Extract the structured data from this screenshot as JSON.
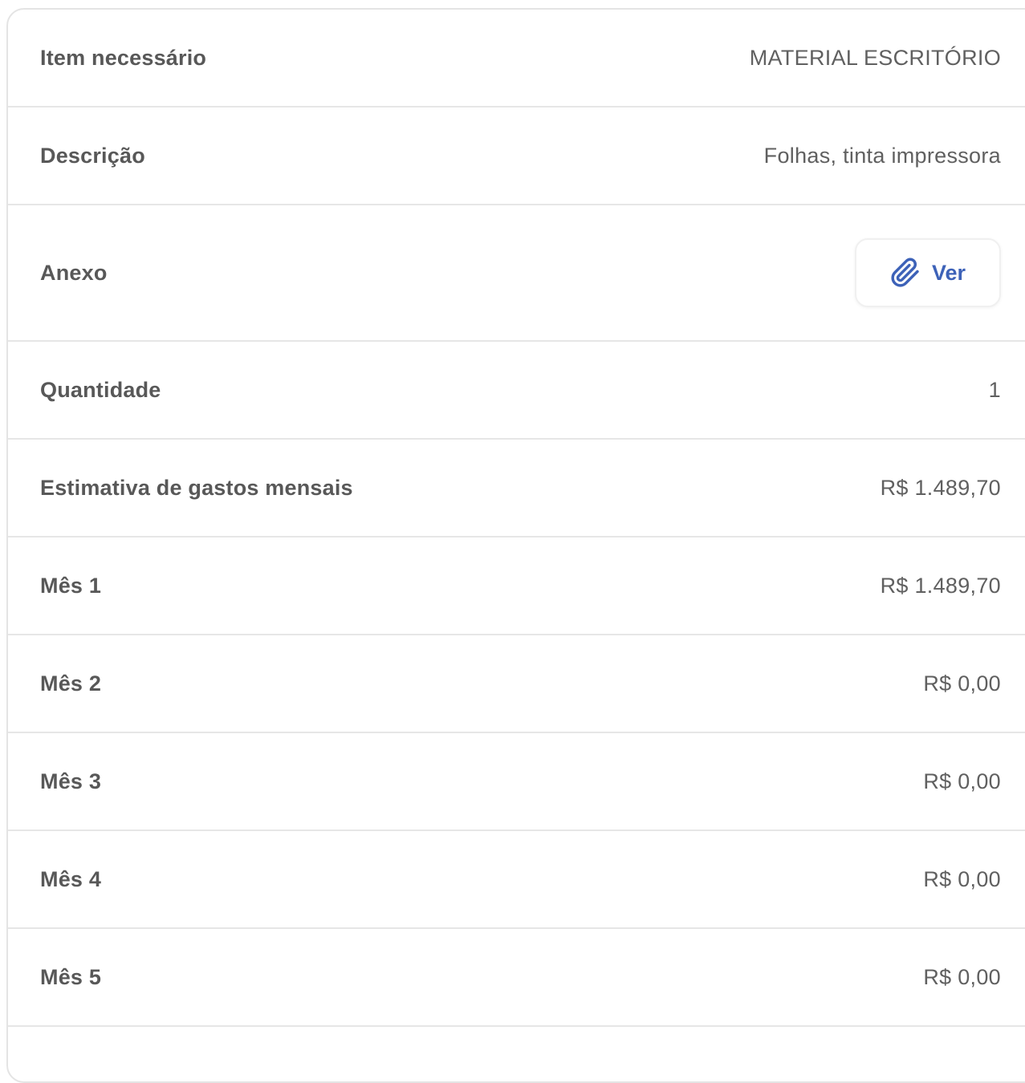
{
  "details": {
    "rows": [
      {
        "label": "Item necessário",
        "value": "MATERIAL ESCRITÓRIO"
      },
      {
        "label": "Descrição",
        "value": "Folhas, tinta impressora"
      },
      {
        "label": "Anexo",
        "button_label": "Ver",
        "button_icon": "paperclip-icon"
      },
      {
        "label": "Quantidade",
        "value": "1"
      },
      {
        "label": "Estimativa de gastos mensais",
        "value": "R$ 1.489,70"
      },
      {
        "label": "Mês 1",
        "value": "R$ 1.489,70"
      },
      {
        "label": "Mês 2",
        "value": "R$ 0,00"
      },
      {
        "label": "Mês 3",
        "value": "R$ 0,00"
      },
      {
        "label": "Mês 4",
        "value": "R$ 0,00"
      },
      {
        "label": "Mês 5",
        "value": "R$ 0,00"
      }
    ]
  },
  "colors": {
    "accent": "#3d62b8",
    "label_text": "#585858",
    "value_text": "#606060",
    "divider": "#e6e6e6"
  }
}
